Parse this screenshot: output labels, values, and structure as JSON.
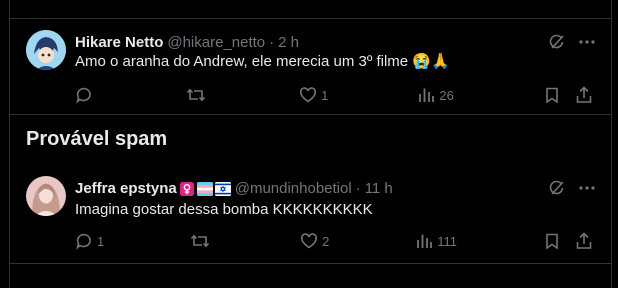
{
  "section": {
    "title": "Provável spam"
  },
  "tweets": [
    {
      "name": "Hikare Netto",
      "handle": "@hikare_netto",
      "separator": "·",
      "time": "2 h",
      "text": "Amo o aranha do Andrew, ele merecia um 3º filme 😭🙏",
      "reply_count": "",
      "retweet_count": "",
      "like_count": "1",
      "view_count": "26"
    },
    {
      "name": "Jeffra epstyna",
      "handle": "@mundinhobetiol",
      "separator": "·",
      "time": "11 h",
      "text": "Imagina gostar dessa bomba KKKKKKKKKK",
      "reply_count": "1",
      "retweet_count": "",
      "like_count": "2",
      "view_count": "111"
    }
  ],
  "colors": {
    "background": "#000000",
    "text": "#e7e9ea",
    "muted": "#71767b",
    "border": "#2f3336"
  }
}
